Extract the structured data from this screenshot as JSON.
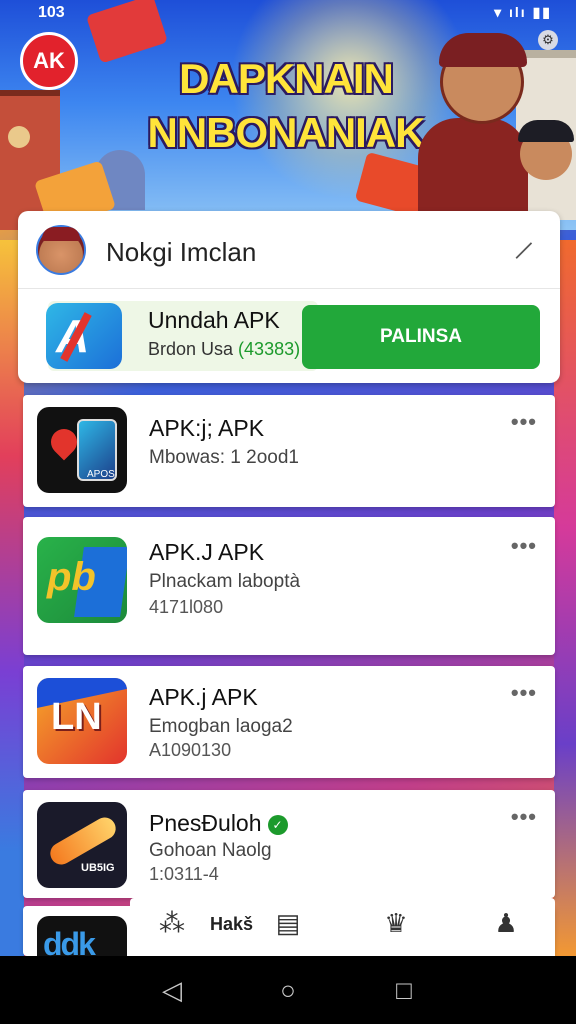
{
  "status_bar": {
    "time": "103",
    "icons": "▾ ılı ▮▮"
  },
  "banner": {
    "logo_text": "AK",
    "title_line1": "DAPKNAIN",
    "title_line2": "NNBONANIAK"
  },
  "header_card": {
    "title": "Nokgi Imclan",
    "download": {
      "app_name": "Unndah APK",
      "subtitle_prefix": "Brdon Usa ",
      "subtitle_highlight": "(43383)",
      "button_label": "PALINSA"
    }
  },
  "app_list": [
    {
      "name": "APK:j; APK",
      "sub": "Mbowas: 1 2ood1",
      "sub2": "",
      "icon": "map-pin-phone-icon",
      "icon_tag": "APOS"
    },
    {
      "name": "APK.J APK",
      "sub": "Plnackam laboptà",
      "sub2": "4171l080",
      "icon": "pb-letters-icon",
      "icon_tag": "pb"
    },
    {
      "name": "APK.j APK",
      "sub": "Emogban laoga2",
      "sub2": "A1090130",
      "icon": "ln-sign-icon",
      "icon_tag": "LN"
    },
    {
      "name": "PnesĐuloh",
      "sub": "Gohoan Naolg",
      "sub2": "1:0311-4",
      "icon": "brush-stroke-icon",
      "icon_tag": "UB5IG",
      "verified": true
    },
    {
      "name": "",
      "sub": "",
      "sub2": "",
      "icon": "partial-app-icon",
      "icon_tag": "ddk"
    }
  ],
  "tab_bar": {
    "tab1_label": "Hakš"
  },
  "colors": {
    "accent_green": "#22a83a",
    "text_dark": "#111111"
  }
}
